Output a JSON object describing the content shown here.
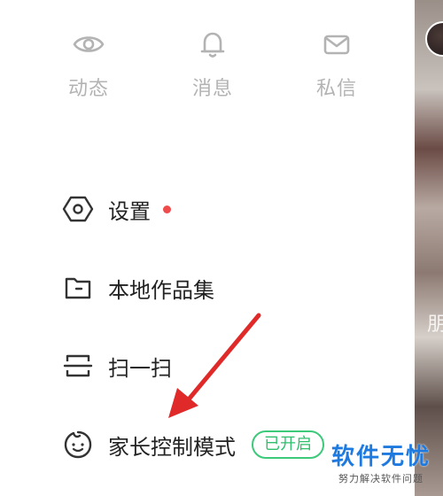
{
  "quick_actions": [
    {
      "label": "动态",
      "icon": "eye-icon"
    },
    {
      "label": "消息",
      "icon": "bell-icon"
    },
    {
      "label": "私信",
      "icon": "mail-icon"
    }
  ],
  "menu": {
    "settings": {
      "label": "设置",
      "icon": "hexagon-settings-icon",
      "has_red_dot": true
    },
    "local_works": {
      "label": "本地作品集",
      "icon": "folder-icon"
    },
    "scan": {
      "label": "扫一扫",
      "icon": "scan-icon"
    },
    "parental_mode": {
      "label": "家长控制模式",
      "icon": "child-face-icon",
      "badge": "已开启"
    }
  },
  "background": {
    "peek_text": "朋"
  },
  "watermark": {
    "main": "软件无忧",
    "sub": "努力解决软件问题"
  },
  "colors": {
    "accent_green": "#3cc97a",
    "red_dot": "#f04b4b",
    "arrow": "#e02a2a",
    "watermark_blue": "#1f7ae0"
  }
}
